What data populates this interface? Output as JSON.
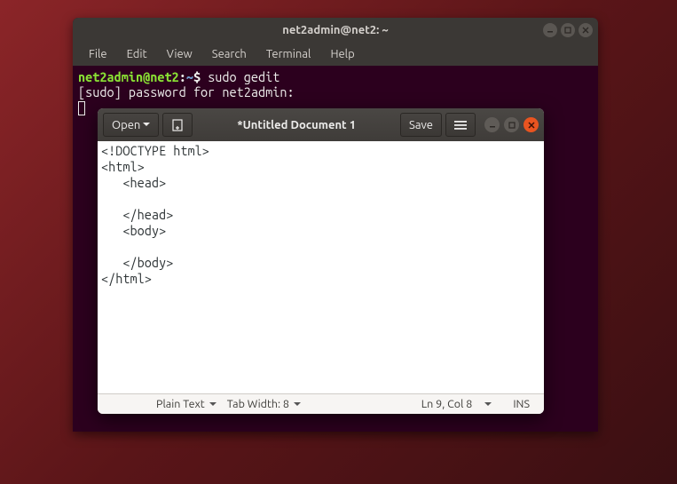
{
  "terminal": {
    "title": "net2admin@net2: ~",
    "menu": {
      "file": "File",
      "edit": "Edit",
      "view": "View",
      "search": "Search",
      "terminal": "Terminal",
      "help": "Help"
    },
    "prompt": {
      "userhost": "net2admin@net2",
      "colon": ":",
      "path": "~",
      "dollar": "$"
    },
    "command": "sudo gedit",
    "line2": "[sudo] password for net2admin:"
  },
  "gedit": {
    "open_label": "Open",
    "save_label": "Save",
    "title": "*Untitled Document 1",
    "content": "<!DOCTYPE html>\n<html>\n   <head>\n\n   </head>\n   <body>\n\n   </body>\n</html>",
    "statusbar": {
      "language": "Plain Text",
      "tabwidth": "Tab Width: 8",
      "position": "Ln 9, Col 8",
      "insert_mode": "INS"
    }
  }
}
